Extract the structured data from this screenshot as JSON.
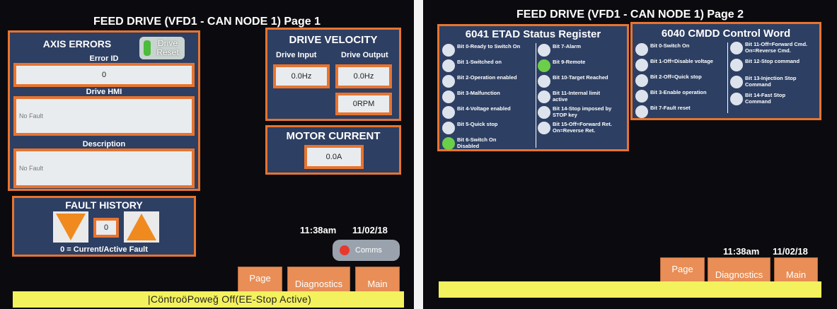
{
  "screen1": {
    "title": "FEED DRIVE (VFD1 - CAN NODE 1) Page 1",
    "axis_errors": {
      "title": "AXIS ERRORS",
      "drive_reset_label": "Drive\nReset",
      "error_id_label": "Error ID",
      "error_id_value": "0",
      "drive_hmi_label": "Drive HMI",
      "drive_hmi_value": "No Fault",
      "description_label": "Description",
      "description_value": "No Fault"
    },
    "drive_velocity": {
      "title": "DRIVE VELOCITY",
      "input_label": "Drive Input",
      "output_label": "Drive Output",
      "input_value": "0.0Hz",
      "output_value": "0.0Hz",
      "rpm_value": "0RPM"
    },
    "motor_current": {
      "title": "MOTOR CURRENT",
      "value": "0.0A"
    },
    "fault_history": {
      "title": "FAULT HISTORY",
      "index": "0",
      "note": "0 = Current/Active Fault"
    },
    "time": "11:38am",
    "date": "11/02/18",
    "comms_label": "Comms",
    "nav": {
      "page_label": "Page",
      "diagnostics_label": "Diagnostics",
      "main_label": "Main"
    },
    "status_text": "|CöntroöPoweǧ Off(EE-Stop Active)"
  },
  "screen2": {
    "title": "FEED DRIVE (VFD1 - CAN NODE 1) Page 2",
    "status_register": {
      "title": "6041 ETAD Status Register",
      "left_bits": [
        {
          "text": "Bit 0-Ready to Switch On",
          "state": "off"
        },
        {
          "text": "Bit 1-Switched on",
          "state": "off"
        },
        {
          "text": "Bit 2-Operation enabled",
          "state": "off"
        },
        {
          "text": "Bit 3-Malfunction",
          "state": "off"
        },
        {
          "text": "Bit 4-Voltage enabled",
          "state": "off"
        },
        {
          "text": "Bit 5-Quick stop",
          "state": "off"
        },
        {
          "text": "Bit 6-Switch On\nDisabled",
          "state": "on"
        }
      ],
      "right_bits": [
        {
          "text": "Bit 7-Alarm",
          "state": "off"
        },
        {
          "text": "Bit 9-Remote",
          "state": "on"
        },
        {
          "text": "Bit 10-Target Reached",
          "state": "off"
        },
        {
          "text": "Bit 11-Internal limit\nactive",
          "state": "off"
        },
        {
          "text": "Bit 14-Stop imposed by\nSTOP key",
          "state": "off"
        },
        {
          "text": "Bit 15-Off=Forward Ret.\nOn=Reverse Ret.",
          "state": "off"
        }
      ]
    },
    "control_word": {
      "title": "6040 CMDD Control Word",
      "left_bits": [
        {
          "text": "Bit 0-Switch On",
          "state": "off"
        },
        {
          "text": "Bit 1-Off=Disable voltage",
          "state": "off"
        },
        {
          "text": "Bit 2-Off=Quick stop",
          "state": "off"
        },
        {
          "text": "Bit 3-Enable operation",
          "state": "off"
        },
        {
          "text": "Bit 7-Fault reset",
          "state": "off"
        }
      ],
      "right_bits": [
        {
          "text": "Bit 11-Off=Forward Cmd.\nOn=Reverse Cmd.",
          "state": "off"
        },
        {
          "text": "Bit 12-Stop command",
          "state": "off"
        },
        {
          "text": "Bit 13-Injection Stop\nCommand",
          "state": "off"
        },
        {
          "text": "Bit 14-Fast Stop\nCommand",
          "state": "off"
        }
      ]
    },
    "time": "11:38am",
    "date": "11/02/18",
    "nav": {
      "page_label": "Page",
      "diagnostics_label": "Diagnostics",
      "main_label": "Main"
    }
  },
  "colors": {
    "accent": "#e8742f",
    "panel": "#2d3f63",
    "status_bar": "#f3f15d",
    "led_on": "#6ccf4a"
  }
}
